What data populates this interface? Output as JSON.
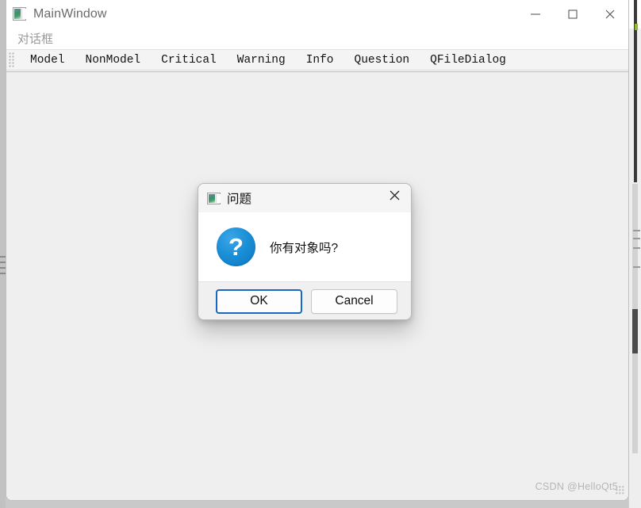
{
  "window": {
    "title": "MainWindow",
    "icon": "qt-app-icon",
    "controls": {
      "minimize": "minimize-icon",
      "maximize": "maximize-icon",
      "close": "close-icon"
    }
  },
  "menubar": {
    "items": [
      {
        "label": "对话框"
      }
    ]
  },
  "toolbar": {
    "handle": "drag-handle",
    "items": [
      {
        "label": "Model"
      },
      {
        "label": "NonModel"
      },
      {
        "label": "Critical"
      },
      {
        "label": "Warning"
      },
      {
        "label": "Info"
      },
      {
        "label": "Question"
      },
      {
        "label": "QFileDialog"
      }
    ]
  },
  "dialog": {
    "title": "问题",
    "icon": "qt-app-icon",
    "close_icon": "close-icon",
    "message": "你有对象吗?",
    "message_icon": "question-mark-icon",
    "message_icon_color": "#1b8fd6",
    "buttons": [
      {
        "label": "OK",
        "style": "default"
      },
      {
        "label": "Cancel",
        "style": "normal"
      }
    ]
  },
  "watermark": {
    "text": "CSDN @HelloQt5"
  },
  "colors": {
    "client_background": "#efefef",
    "toolbar_background": "#f4f4f4",
    "title_background": "#ffffff",
    "accent": "#1668c4",
    "desktop": "#c9c9c9"
  }
}
